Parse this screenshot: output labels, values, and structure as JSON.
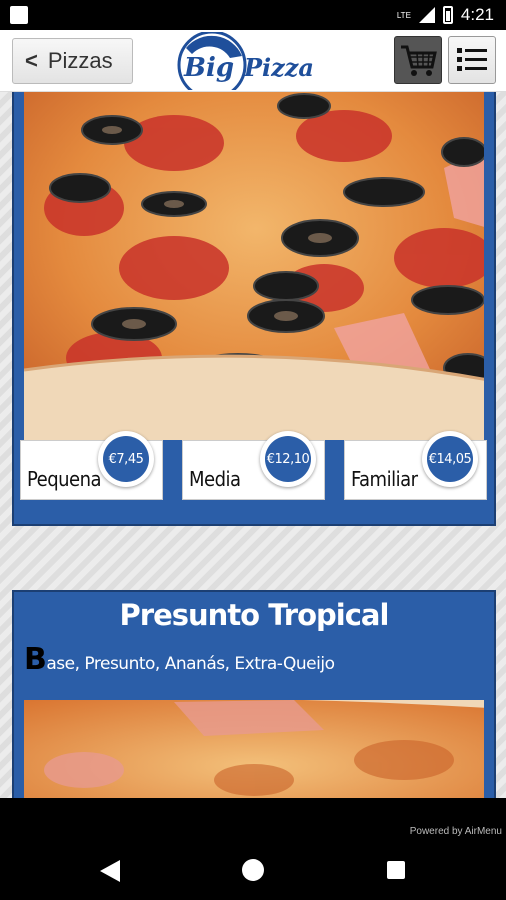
{
  "status_bar": {
    "network": "LTE",
    "time": "4:21"
  },
  "header": {
    "back_label": "Pizzas",
    "back_icon": "<",
    "logo_text_big": "Big",
    "logo_text_pizza": "Pizza"
  },
  "products": [
    {
      "sizes": [
        {
          "label": "Pequena",
          "price": "€7,45"
        },
        {
          "label": "Media",
          "price": "€12,10"
        },
        {
          "label": "Familiar",
          "price": "€14,05"
        }
      ]
    },
    {
      "title": "Presunto Tropical",
      "desc_initial": "B",
      "desc_rest": "ase, Presunto, Ananás, Extra-Queijo"
    }
  ],
  "footer": {
    "powered_by": "Powered by AirMenu"
  },
  "colors": {
    "brand_blue": "#2b5ea8",
    "card_border": "#1c3f73"
  }
}
